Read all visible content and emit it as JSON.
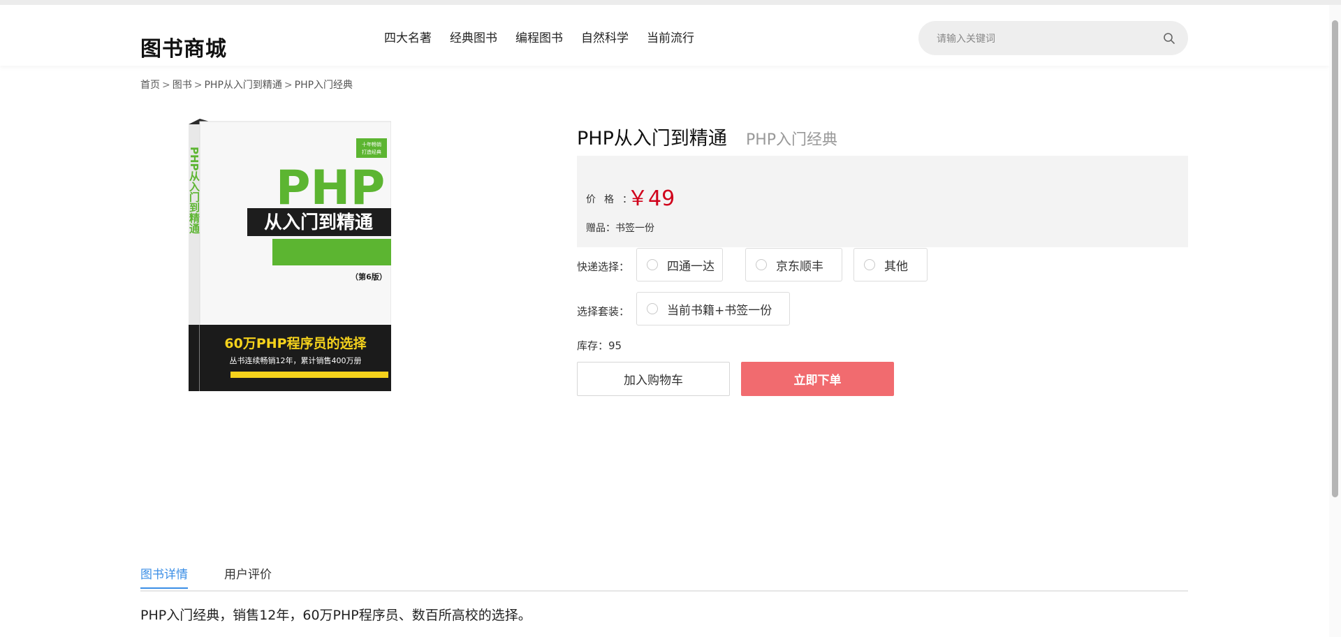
{
  "header": {
    "logo": "图书商城",
    "nav": [
      "四大名著",
      "经典图书",
      "编程图书",
      "自然科学",
      "当前流行"
    ],
    "search_placeholder": "请输入关键词"
  },
  "breadcrumb": [
    "首页",
    "图书",
    "PHP从入门到精通",
    "PHP入门经典"
  ],
  "breadcrumb_sep": ">",
  "cover": {
    "badge_top": "十年畅销",
    "badge_bottom": "打造经典",
    "spine_title": "PHP从入门到精通",
    "title_big": "PHP",
    "title_cn": "从入门到精通",
    "edition": "（第6版）",
    "banner_line1": "60万PHP程序员的选择",
    "banner_line2": "丛书连续畅销12年，累计销售400万册"
  },
  "product": {
    "title": "PHP从入门到精通",
    "subtitle": "PHP入门经典",
    "price_label": "价格",
    "price_colon": "：",
    "price": "￥49",
    "gift": "赠品：书签一份",
    "express_label": "快递选择：",
    "express_options": [
      "四通一达",
      "京东顺丰",
      "其他"
    ],
    "bundle_label": "选择套装：",
    "bundle_options": [
      "当前书籍+书签一份"
    ],
    "stock": "库存：95",
    "add_cart": "加入购物车",
    "buy_now": "立即下单"
  },
  "tabs": [
    "图书详情",
    "用户评价"
  ],
  "description": "PHP入门经典，销售12年，60万PHP程序员、数百所高校的选择。",
  "colors": {
    "accent": "#3a8ee6",
    "price": "#d0021b",
    "order_button": "#f16b6f",
    "cover_green": "#5cb531"
  }
}
